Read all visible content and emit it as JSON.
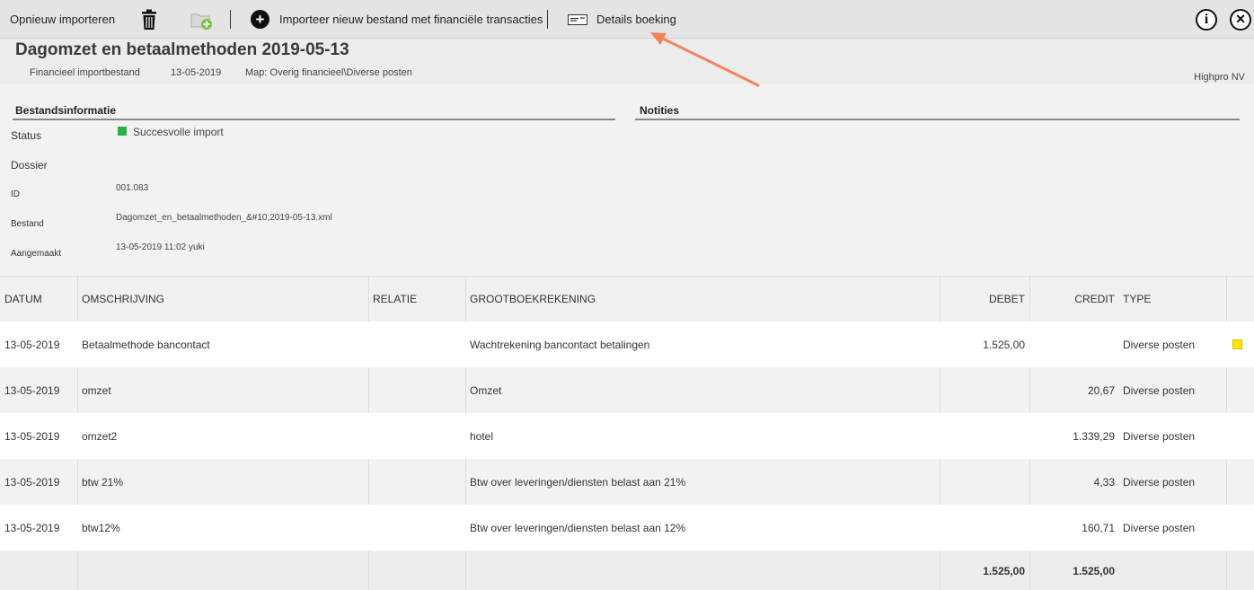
{
  "toolbar": {
    "reimport_label": "Opnieuw importeren",
    "import_new_label": "Importeer nieuw bestand met financiële transacties",
    "details_label": "Details boeking",
    "info_symbol": "i",
    "close_symbol": "×"
  },
  "header": {
    "title": "Dagomzet en betaalmethoden 2019-05-13",
    "type": "Financieel importbestand",
    "date": "13-05-2019",
    "folder": "Map: Overig financieel\\Diverse posten",
    "company": "Highpro NV"
  },
  "info": {
    "section_title": "Bestandsinformatie",
    "notes_title": "Notities",
    "status_label": "Status",
    "status_value": "Succesvolle import",
    "dossier_label": "Dossier",
    "dossier_value": "",
    "id_label": "ID",
    "id_value": "001.083",
    "file_label": "Bestand",
    "file_value": "Dagomzet_en_betaalmethoden_&#10;2019-05-13.xml",
    "created_label": "Aangemaakt",
    "created_value": "13-05-2019 11:02 yuki"
  },
  "table": {
    "columns": [
      "DATUM",
      "OMSCHRIJVING",
      "RELATIE",
      "GROOTBOEKREKENING",
      "DEBET",
      "CREDIT",
      "TYPE"
    ],
    "rows": [
      {
        "date": "13-05-2019",
        "desc": "Betaalmethode bancontact",
        "relation": "",
        "ledger": "Wachtrekening bancontact betalingen",
        "debit": "1.525,00",
        "credit": "",
        "type": "Diverse posten",
        "flag": true
      },
      {
        "date": "13-05-2019",
        "desc": "omzet",
        "relation": "",
        "ledger": "Omzet",
        "debit": "",
        "credit": "20,67",
        "type": "Diverse posten",
        "flag": false
      },
      {
        "date": "13-05-2019",
        "desc": "omzet2",
        "relation": "",
        "ledger": "hotel",
        "debit": "",
        "credit": "1.339,29",
        "type": "Diverse posten",
        "flag": false
      },
      {
        "date": "13-05-2019",
        "desc": "btw 21%",
        "relation": "",
        "ledger": "Btw over leveringen/diensten belast aan 21%",
        "debit": "",
        "credit": "4,33",
        "type": "Diverse posten",
        "flag": false
      },
      {
        "date": "13-05-2019",
        "desc": "btw12%",
        "relation": "",
        "ledger": "Btw over leveringen/diensten belast aan 12%",
        "debit": "",
        "credit": "160,71",
        "type": "Diverse posten",
        "flag": false
      }
    ],
    "totals": {
      "debit": "1.525,00",
      "credit": "1.525,00"
    }
  },
  "colors": {
    "status_ok": "#2bb14a",
    "flag_yellow": "#ffe600",
    "annotation_arrow": "#f0845a"
  }
}
